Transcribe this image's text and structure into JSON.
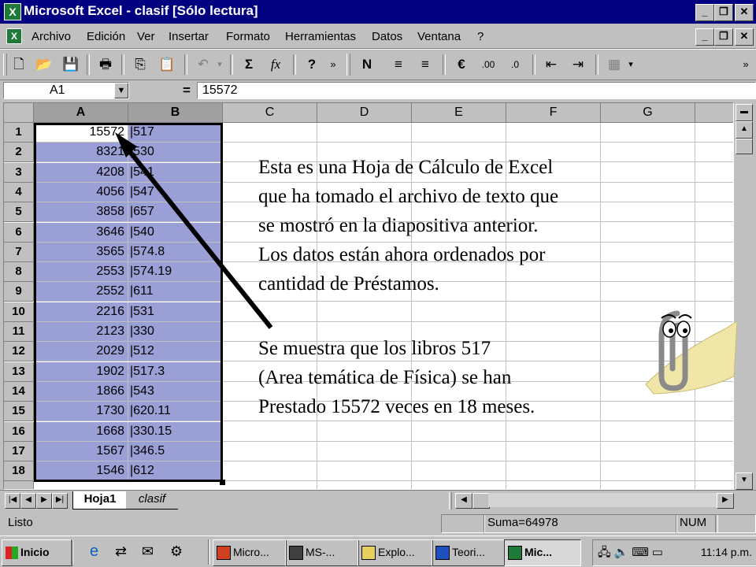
{
  "window": {
    "title": "Microsoft Excel - clasif  [Sólo lectura]"
  },
  "menu": [
    "Archivo",
    "Edición",
    "Ver",
    "Insertar",
    "Formato",
    "Herramientas",
    "Datos",
    "Ventana",
    "?"
  ],
  "formula_bar": {
    "cell_ref": "A1",
    "equals": "=",
    "value": "15572"
  },
  "columns": [
    "A",
    "B",
    "C",
    "D",
    "E",
    "F",
    "G"
  ],
  "rows": [
    {
      "n": "1",
      "a": "15572",
      "b": "|517"
    },
    {
      "n": "2",
      "a": "8321",
      "b": "|530"
    },
    {
      "n": "3",
      "a": "4208",
      "b": "|541"
    },
    {
      "n": "4",
      "a": "4056",
      "b": "|547"
    },
    {
      "n": "5",
      "a": "3858",
      "b": "|657"
    },
    {
      "n": "6",
      "a": "3646",
      "b": "|540"
    },
    {
      "n": "7",
      "a": "3565",
      "b": "|574.8"
    },
    {
      "n": "8",
      "a": "2553",
      "b": "|574.19"
    },
    {
      "n": "9",
      "a": "2552",
      "b": "|611"
    },
    {
      "n": "10",
      "a": "2216",
      "b": "|531"
    },
    {
      "n": "11",
      "a": "2123",
      "b": "|330"
    },
    {
      "n": "12",
      "a": "2029",
      "b": "|512"
    },
    {
      "n": "13",
      "a": "1902",
      "b": "|517.3"
    },
    {
      "n": "14",
      "a": "1866",
      "b": "|543"
    },
    {
      "n": "15",
      "a": "1730",
      "b": "|620.11"
    },
    {
      "n": "16",
      "a": "1668",
      "b": "|330.15"
    },
    {
      "n": "17",
      "a": "1567",
      "b": "|346.5"
    },
    {
      "n": "18",
      "a": "1546",
      "b": "|612"
    }
  ],
  "sheet_tabs": [
    "Hoja1",
    "clasif"
  ],
  "status": {
    "ready": "Listo",
    "sum": "Suma=64978",
    "num": "NUM"
  },
  "overlay": {
    "paragraph1": [
      "Esta es una Hoja de Cálculo de Excel",
      "que ha tomado el archivo de texto que",
      "se mostró en la diapositiva anterior.",
      "Los datos están ahora ordenados por",
      "cantidad de Préstamos."
    ],
    "paragraph2": [
      "Se muestra que los libros 517",
      "(Area temática de Física) se han",
      "Prestado 15572 veces en 18 meses."
    ]
  },
  "taskbar": {
    "start": "Inicio",
    "buttons": [
      "Micro...",
      "MS-...",
      "Explo...",
      "Teori...",
      "Mic..."
    ],
    "clock": "11:14 p.m."
  },
  "colors": {
    "titlebar": "#000080",
    "selection": "#9a9fd6",
    "chrome": "#c0c0c0"
  },
  "icons": [
    "excel-app-icon",
    "new-icon",
    "open-icon",
    "save-icon",
    "print-icon",
    "copy-icon",
    "paste-icon",
    "undo-icon",
    "autosum-icon",
    "function-icon",
    "help-icon",
    "bold-icon",
    "align-left-icon",
    "align-center-icon",
    "euro-icon",
    "increase-decimal-icon",
    "decrease-decimal-icon",
    "decrease-indent-icon",
    "increase-indent-icon",
    "borders-icon",
    "office-assistant-clip-icon"
  ]
}
